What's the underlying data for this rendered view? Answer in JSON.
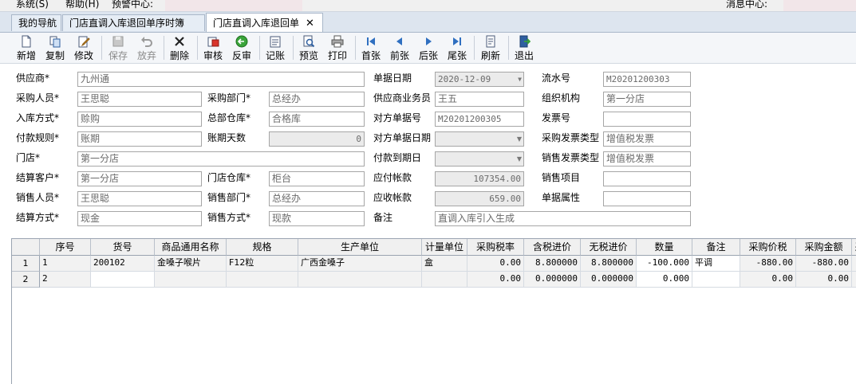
{
  "menu": {
    "system": "系统(S)",
    "help": "帮助(H)",
    "alert_center": "预警中心:",
    "message_center": "消息中心:"
  },
  "tabs": [
    {
      "label": "我的导航"
    },
    {
      "label": "门店直调入库退回单序时簿"
    },
    {
      "label": "门店直调入库退回单",
      "close": "✕"
    }
  ],
  "toolbar": [
    {
      "label": "新增",
      "icon": "new-doc-icon"
    },
    {
      "label": "复制",
      "icon": "copy-icon"
    },
    {
      "label": "修改",
      "icon": "edit-icon"
    },
    {
      "label": "保存",
      "icon": "save-icon",
      "disabled": true
    },
    {
      "label": "放弃",
      "icon": "undo-icon",
      "disabled": true
    },
    {
      "label": "删除",
      "icon": "delete-icon"
    },
    {
      "label": "审核",
      "icon": "approve-icon"
    },
    {
      "label": "反审",
      "icon": "unapprove-icon"
    },
    {
      "label": "记账",
      "icon": "post-icon"
    },
    {
      "label": "预览",
      "icon": "preview-icon"
    },
    {
      "label": "打印",
      "icon": "print-icon"
    },
    {
      "label": "首张",
      "icon": "first-icon"
    },
    {
      "label": "前张",
      "icon": "prev-icon"
    },
    {
      "label": "后张",
      "icon": "next-icon"
    },
    {
      "label": "尾张",
      "icon": "last-icon"
    },
    {
      "label": "刷新",
      "icon": "refresh-icon"
    },
    {
      "label": "退出",
      "icon": "exit-icon"
    }
  ],
  "form": {
    "supplier": {
      "label": "供应商*",
      "value": "九州通"
    },
    "doc_date": {
      "label": "单据日期",
      "value": "2020-12-09"
    },
    "serial_no": {
      "label": "流水号",
      "value": "M20201200303"
    },
    "buyer": {
      "label": "采购人员*",
      "value": "王思聪"
    },
    "purchase_dept": {
      "label": "采购部门*",
      "value": "总经办"
    },
    "supplier_clerk": {
      "label": "供应商业务员",
      "value": "王五"
    },
    "org": {
      "label": "组织机构",
      "value": "第一分店"
    },
    "in_method": {
      "label": "入库方式*",
      "value": "赊购"
    },
    "hq_warehouse": {
      "label": "总部仓库*",
      "value": "合格库"
    },
    "counter_doc_no": {
      "label": "对方单据号",
      "value": "M20201200305"
    },
    "invoice_no": {
      "label": "发票号",
      "value": ""
    },
    "pay_rule": {
      "label": "付款规则*",
      "value": "账期"
    },
    "credit_days": {
      "label": "账期天数",
      "value": "0"
    },
    "counter_doc_date": {
      "label": "对方单据日期",
      "value": ""
    },
    "purchase_invoice_type": {
      "label": "采购发票类型",
      "value": "增值税发票"
    },
    "store": {
      "label": "门店*",
      "value": "第一分店"
    },
    "pay_due_date": {
      "label": "付款到期日",
      "value": ""
    },
    "sales_invoice_type": {
      "label": "销售发票类型",
      "value": "增值税发票"
    },
    "settle_customer": {
      "label": "结算客户*",
      "value": "第一分店"
    },
    "store_warehouse": {
      "label": "门店仓库*",
      "value": "柜台"
    },
    "payable": {
      "label": "应付帐款",
      "value": "107354.00"
    },
    "sales_item": {
      "label": "销售项目",
      "value": ""
    },
    "sales_person": {
      "label": "销售人员*",
      "value": "王思聪"
    },
    "sales_dept": {
      "label": "销售部门*",
      "value": "总经办"
    },
    "receivable": {
      "label": "应收帐款",
      "value": "659.00"
    },
    "doc_attr": {
      "label": "单据属性",
      "value": ""
    },
    "settle_method": {
      "label": "结算方式*",
      "value": "现金"
    },
    "sales_method": {
      "label": "销售方式*",
      "value": "现款"
    },
    "remark": {
      "label": "备注",
      "value": "直调入库引入生成"
    }
  },
  "grid": {
    "columns": [
      "序号",
      "货号",
      "商品通用名称",
      "规格",
      "生产单位",
      "计量单位",
      "采购税率",
      "含税进价",
      "无税进价",
      "数量",
      "备注",
      "采购价税",
      "采购金额",
      "采"
    ],
    "rows": [
      {
        "row_no": "1",
        "cells": [
          "1",
          "200102",
          "金嗓子喉片",
          "F12粒",
          "广西金嗓子",
          "盒",
          "0.00",
          "8.800000",
          "8.800000",
          "-100.000",
          "平调",
          "-880.00",
          "-880.00",
          ""
        ]
      },
      {
        "row_no": "2",
        "cells": [
          "2",
          "",
          "",
          "",
          "",
          "",
          "0.00",
          "0.000000",
          "0.000000",
          "0.000",
          "",
          "0.00",
          "0.00",
          ""
        ]
      }
    ]
  }
}
